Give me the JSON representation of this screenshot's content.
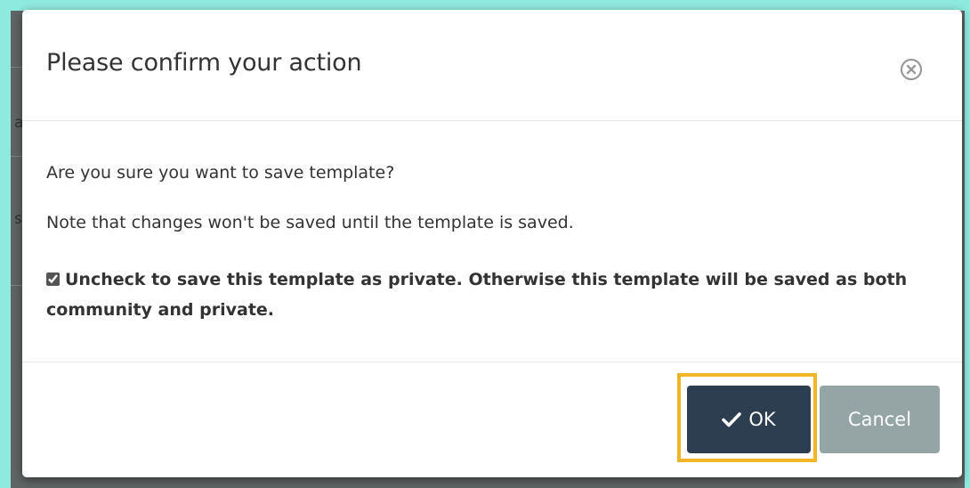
{
  "modal": {
    "title": "Please confirm your action",
    "body": {
      "question": "Are you sure you want to save template?",
      "note": "Note that changes won't be saved until the template is saved.",
      "checkbox_label": "Uncheck to save this template as private. Otherwise this template will be saved as both community and private.",
      "checkbox_checked": true
    },
    "footer": {
      "ok_label": "OK",
      "cancel_label": "Cancel"
    }
  },
  "background": {
    "glyph_1": "a",
    "glyph_2": "s"
  },
  "icons": {
    "close": "close-circle-icon",
    "ok": "check-icon"
  },
  "colors": {
    "frame": "#8ee9df",
    "ok_button": "#2c3e50",
    "cancel_button": "#95a5a6",
    "highlight": "#f2b527"
  }
}
